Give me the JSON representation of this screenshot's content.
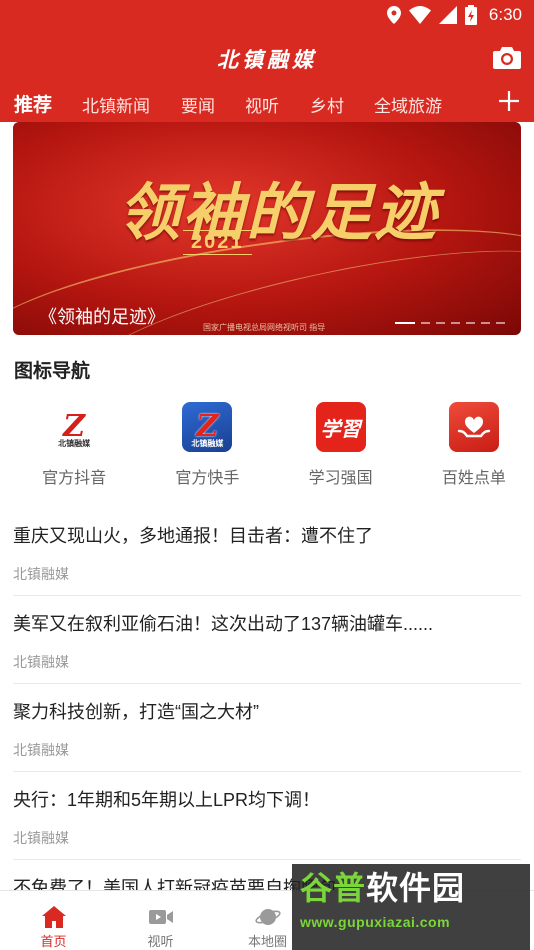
{
  "status_bar": {
    "time": "6:30"
  },
  "app_bar": {
    "title": "北镇融媒"
  },
  "tabs": [
    {
      "label": "推荐",
      "active": true
    },
    {
      "label": "北镇新闻"
    },
    {
      "label": "要闻"
    },
    {
      "label": "视听"
    },
    {
      "label": "乡村"
    },
    {
      "label": "全域旅游"
    }
  ],
  "banner": {
    "art_title": "领袖的足迹",
    "art_year": "2021",
    "caption": "《领袖的足迹》",
    "credit": "国家广播电视总局网络视听司 指导",
    "slide_count": 7,
    "active_slide": 1
  },
  "icon_nav": {
    "title": "图标导航",
    "items": [
      {
        "label": "官方抖音",
        "icon": "beizhen-logo-icon",
        "icon_text": "北镇融媒"
      },
      {
        "label": "官方快手",
        "icon": "beizhen-logo-icon",
        "icon_text": "北镇融媒"
      },
      {
        "label": "学习强国",
        "icon": "xuexi-icon",
        "icon_text": "学習"
      },
      {
        "label": "百姓点单",
        "icon": "heart-hands-icon"
      }
    ]
  },
  "news": [
    {
      "headline": "重庆又现山火，多地通报！目击者：遭不住了",
      "source": "北镇融媒"
    },
    {
      "headline": "美军又在叙利亚偷石油！这次出动了137辆油罐车......",
      "source": "北镇融媒"
    },
    {
      "headline": "聚力科技创新，打造“国之大材”",
      "source": "北镇融媒"
    },
    {
      "headline": "央行：1年期和5年期以上LPR均下调！",
      "source": "北镇融媒"
    },
    {
      "headline": "不免费了！美国人打新冠疫苗要自掏腰包"
    }
  ],
  "bottom_nav": [
    {
      "label": "首页",
      "icon": "home-icon",
      "active": true
    },
    {
      "label": "视听",
      "icon": "video-icon"
    },
    {
      "label": "本地圈",
      "icon": "planet-icon"
    }
  ],
  "watermark": {
    "line1_a": "谷普",
    "line1_b": "软件园",
    "line2": "www.gupuxiazai.com"
  },
  "colors": {
    "brand_red": "#d92a22",
    "banner_gold": "#f6cf6b",
    "watermark_green": "#7bd63a"
  }
}
